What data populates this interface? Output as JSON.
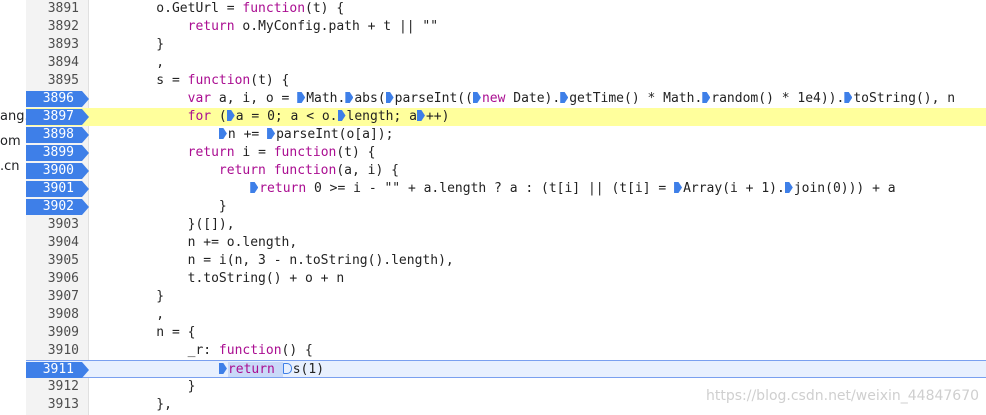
{
  "sidebar": {
    "fragments": [
      "ang.c",
      "om",
      ".cn"
    ]
  },
  "lines": [
    {
      "num": "3891",
      "text": "    o.GetUrl = function(t) {"
    },
    {
      "num": "3892",
      "text": "        return o.MyConfig.path + t || \"\""
    },
    {
      "num": "3893",
      "text": "    }"
    },
    {
      "num": "3894",
      "text": "    ,"
    },
    {
      "num": "3895",
      "text": "    s = function(t) {"
    },
    {
      "num": "3896",
      "text": "        var a, i, o = ",
      "parts": [
        "Math.",
        "abs(",
        "parseInt((",
        "new Date).",
        "getTime() * Math.",
        "random() * 1e4)).",
        "toString(), n"
      ]
    },
    {
      "num": "3897",
      "text": "        for (",
      "parts": [
        "a = 0; a < o.",
        "length; a",
        "++)"
      ]
    },
    {
      "num": "3898",
      "text": "            ",
      "parts": [
        "n += ",
        "parseInt(o[a]);"
      ]
    },
    {
      "num": "3899",
      "text": "        return i = function(t) {"
    },
    {
      "num": "3900",
      "text": "            return function(a, i) {"
    },
    {
      "num": "3901",
      "text": "                ",
      "parts": [
        "return 0 >= i - \"\" + a.length ? a : (t[i] || (t[i] = ",
        "Array(i + 1).",
        "join(0))) + a"
      ]
    },
    {
      "num": "3902",
      "text": "            }"
    },
    {
      "num": "3903",
      "text": "        }([]),"
    },
    {
      "num": "3904",
      "text": "        n += o.length,"
    },
    {
      "num": "3905",
      "text": "        n = i(n, 3 - n.toString().length),"
    },
    {
      "num": "3906",
      "text": "        t.toString() + o + n"
    },
    {
      "num": "3907",
      "text": "    }"
    },
    {
      "num": "3908",
      "text": "    ,"
    },
    {
      "num": "3909",
      "text": "    n = {"
    },
    {
      "num": "3910",
      "text": "        _r: function() {"
    },
    {
      "num": "3911",
      "text": "            ",
      "parts": [
        "return ",
        "s(1)"
      ]
    },
    {
      "num": "3912",
      "text": "        }"
    },
    {
      "num": "3913",
      "text": "    },"
    }
  ],
  "breakpoints": [
    "3896",
    "3897",
    "3898",
    "3899",
    "3900",
    "3901",
    "3902",
    "3911"
  ],
  "paused_line": "3897",
  "current_line": "3911",
  "watermark": "https://blog.csdn.net/weixin_44847670",
  "colors": {
    "breakpoint": "#3e7fe8",
    "paused_bg": "#ffff9c",
    "current_bg": "#e8f0fe",
    "keyword": "#aa0d91"
  }
}
